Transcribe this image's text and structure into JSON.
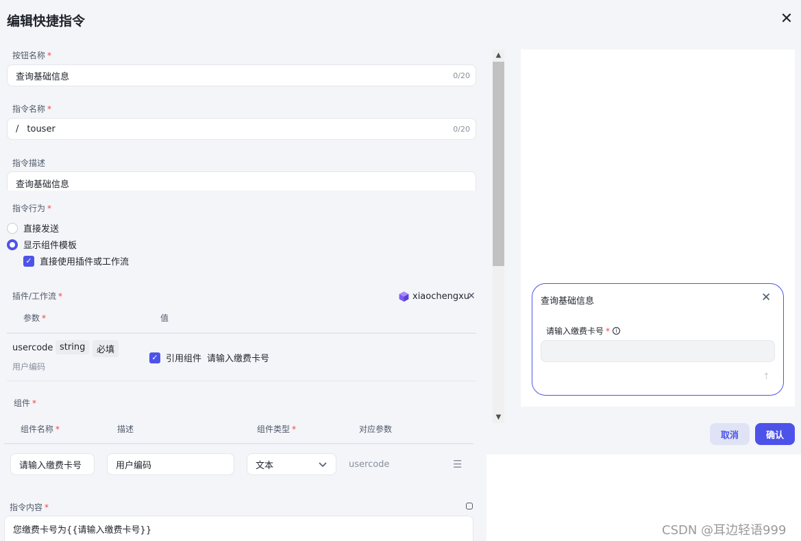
{
  "dialog": {
    "title": "编辑快捷指令"
  },
  "fields": {
    "button_name": {
      "label": "按钮名称",
      "value": "查询基础信息",
      "count": "0/20"
    },
    "command_name": {
      "label": "指令名称",
      "prefix": "/",
      "value": "touser",
      "count": "0/20"
    },
    "command_desc": {
      "label": "指令描述",
      "value": "查询基础信息"
    }
  },
  "behavior": {
    "label": "指令行为",
    "options": [
      "直接发送",
      "显示组件模板"
    ],
    "selected": "显示组件模板",
    "sub_option": "直接使用插件或工作流",
    "sub_checked": true
  },
  "plugin": {
    "label": "插件/工作流",
    "name": "xiaochengxu",
    "columns": [
      "参数",
      "值"
    ],
    "param": {
      "name": "usercode",
      "type": "string",
      "required": "必填",
      "desc": "用户编码",
      "ref_label": "引用组件",
      "ref_value": "请输入缴费卡号"
    }
  },
  "components": {
    "label": "组件",
    "columns": [
      "组件名称",
      "描述",
      "组件类型",
      "对应参数"
    ],
    "row": {
      "name": "请输入缴费卡号",
      "desc": "用户编码",
      "type": "文本",
      "param": "usercode"
    }
  },
  "content": {
    "label": "指令内容",
    "value": "您缴费卡号为{{请输入缴费卡号}}"
  },
  "preview": {
    "card_title": "查询基础信息",
    "field_label": "请输入缴费卡号"
  },
  "footer": {
    "cancel": "取消",
    "confirm": "确认"
  },
  "watermark": "CSDN @耳边轻语999",
  "colors": {
    "accent": "#4d53e8",
    "required": "#f53f3f"
  }
}
